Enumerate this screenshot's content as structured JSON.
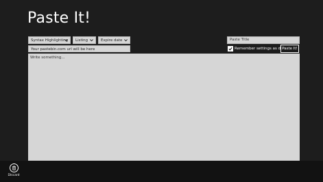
{
  "app": {
    "title": "Paste It!"
  },
  "toolbar": {
    "syntax_select": {
      "value": "Syntax Highlighting"
    },
    "listing_select": {
      "value": "Listing"
    },
    "expire_select": {
      "value": "Expire date"
    },
    "url_field": {
      "value": "Your pastebin.com url will be here"
    }
  },
  "right_panel": {
    "title_input": {
      "placeholder": "Paste Title",
      "value": ""
    },
    "remember_checkbox": {
      "label": "Remember settings as default",
      "checked": true
    },
    "paste_button": {
      "label": "Paste It!"
    }
  },
  "editor": {
    "placeholder": "Write something..."
  },
  "app_bar": {
    "discard": {
      "label": "Discard",
      "icon": "trash-icon"
    }
  },
  "colors": {
    "background": "#1d1d1d",
    "field": "#d6d6d6",
    "app_bar": "#121212",
    "text_dark": "#222222",
    "text_light": "#ffffff"
  }
}
